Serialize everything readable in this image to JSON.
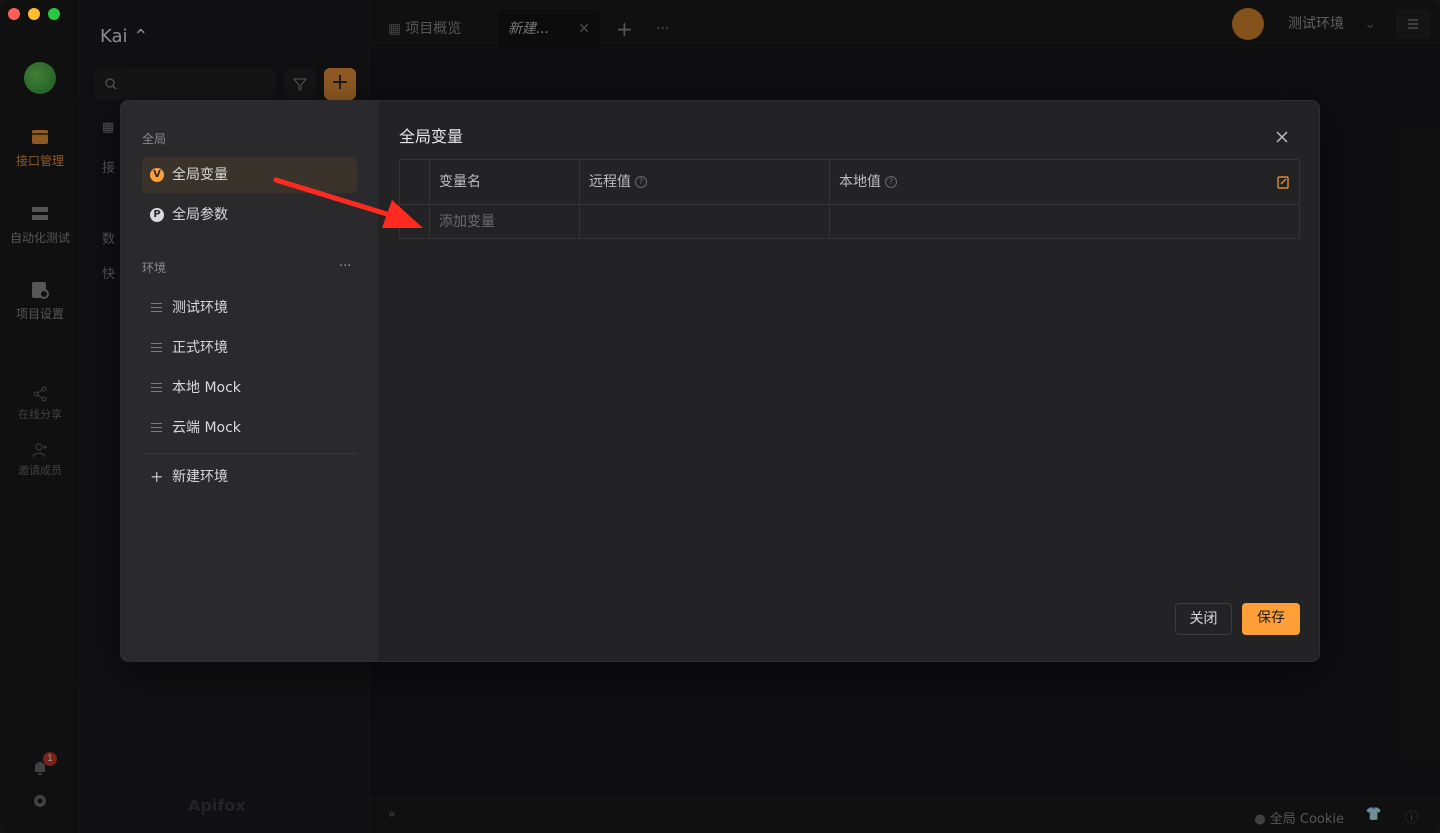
{
  "app": {
    "workspace": "Kai ⌃",
    "rail": [
      {
        "label": "接口管理",
        "icon": "api-management-icon",
        "active": true
      },
      {
        "label": "自动化测试",
        "icon": "automation-test-icon",
        "active": false
      },
      {
        "label": "项目设置",
        "icon": "project-settings-icon",
        "active": false
      },
      {
        "label": "在线分享",
        "icon": "share-icon",
        "active": false
      },
      {
        "label": "邀请成员",
        "icon": "invite-member-icon",
        "active": false
      }
    ],
    "notification_count": "1",
    "sidebar_peek": [
      "接",
      "数",
      "快"
    ],
    "watermark": "Apifox"
  },
  "tabs": {
    "overview": "项目概览",
    "current": "新建...",
    "env_selected": "测试环境"
  },
  "bottom": {
    "cookie": "全局 Cookie"
  },
  "modal": {
    "section_global": "全局",
    "global_vars": "全局变量",
    "global_params": "全局参数",
    "section_env": "环境",
    "env_more": "···",
    "environments": [
      "测试环境",
      "正式环境",
      "本地 Mock",
      "云端 Mock"
    ],
    "new_env": "新建环境",
    "title": "全局变量",
    "columns": {
      "name": "变量名",
      "remote": "远程值",
      "local": "本地值"
    },
    "add_placeholder": "添加变量",
    "close_label": "关闭",
    "save_label": "保存"
  },
  "colors": {
    "accent": "#ff9f38",
    "annotation_arrow": "#ff2a1f"
  }
}
